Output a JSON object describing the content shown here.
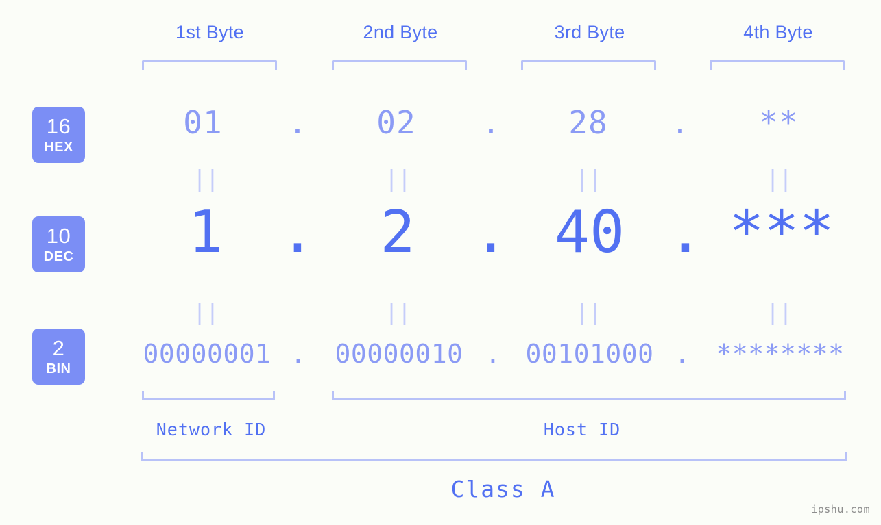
{
  "watermark": "ipshu.com",
  "colors": {
    "background": "#fbfdf8",
    "accent_strong": "#5271f2",
    "accent_light": "#8b9bf5",
    "bracket": "#b8c2f8",
    "badge_bg": "#7b8ef5",
    "connector": "#c5cdfa",
    "watermark": "#8d8d8d"
  },
  "byte_headers": [
    {
      "label": "1st Byte"
    },
    {
      "label": "2nd Byte"
    },
    {
      "label": "3rd Byte"
    },
    {
      "label": "4th Byte"
    }
  ],
  "badges": [
    {
      "num": "16",
      "unit": "HEX"
    },
    {
      "num": "10",
      "unit": "DEC"
    },
    {
      "num": "2",
      "unit": "BIN"
    }
  ],
  "rows": {
    "hex": {
      "base": "16",
      "name": "HEX",
      "octets": [
        "01",
        "02",
        "28",
        "**"
      ],
      "separators": [
        ".",
        ".",
        "."
      ]
    },
    "dec": {
      "base": "10",
      "name": "DEC",
      "octets": [
        "1",
        "2",
        "40",
        "***"
      ],
      "separators": [
        ".",
        ".",
        "."
      ]
    },
    "bin": {
      "base": "2",
      "name": "BIN",
      "octets": [
        "00000001",
        "00000010",
        "00101000",
        "********"
      ],
      "separators": [
        ".",
        ".",
        "."
      ]
    }
  },
  "connectors": {
    "glyph": "||",
    "rows": 2,
    "per_row": 4
  },
  "sections": [
    {
      "label": "Network ID"
    },
    {
      "label": "Host ID"
    }
  ],
  "class": {
    "label": "Class A"
  }
}
